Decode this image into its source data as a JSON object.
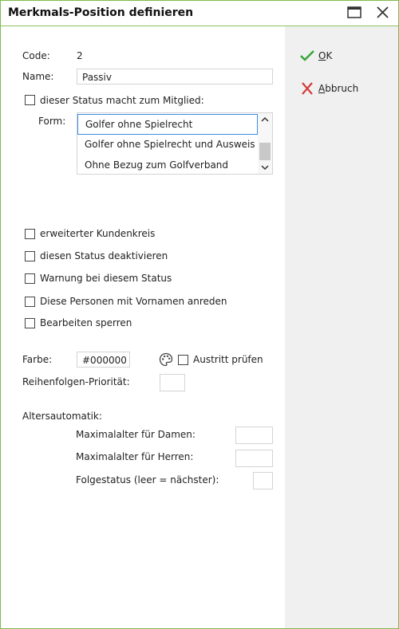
{
  "window": {
    "title": "Merkmals-Position definieren"
  },
  "form": {
    "code_label": "Code:",
    "code_value": "2",
    "name_label": "Name:",
    "name_value": "Passiv",
    "member_status_label": "dieser Status macht zum Mitglied:",
    "form_label": "Form:",
    "form_options": [
      "Golfer ohne Spielrecht",
      "Golfer ohne Spielrecht und Ausweis",
      "Ohne Bezug zum Golfverband"
    ],
    "checkboxes": [
      "erweiterter Kundenkreis",
      "diesen Status deaktivieren",
      "Warnung bei diesem Status",
      "Diese Personen mit Vornamen anreden",
      "Bearbeiten sperren"
    ],
    "color_label": "Farbe:",
    "color_value": "#000000",
    "exit_check_label": "Austritt prüfen",
    "priority_label": "Reihenfolgen-Priorität:",
    "priority_value": "",
    "age_auto_label": "Altersautomatik:",
    "max_age_women_label": "Maximalalter für Damen:",
    "max_age_women_value": "",
    "max_age_men_label": "Maximalalter für Herren:",
    "max_age_men_value": "",
    "next_status_label": "Folgestatus (leer = nächster):",
    "next_status_value": ""
  },
  "actions": {
    "ok_label": "OK",
    "cancel_label": "Abbruch"
  },
  "colors": {
    "accent_green": "#7dbb4a",
    "ok_check": "#3aa53a",
    "cancel_x": "#d23c3c",
    "selection_border": "#3b8ee8",
    "side_panel": "#f0f0f0"
  },
  "icons": {
    "maximize": "maximize-icon",
    "close": "close-icon",
    "ok": "checkmark-icon",
    "cancel": "x-icon",
    "palette": "palette-icon"
  }
}
